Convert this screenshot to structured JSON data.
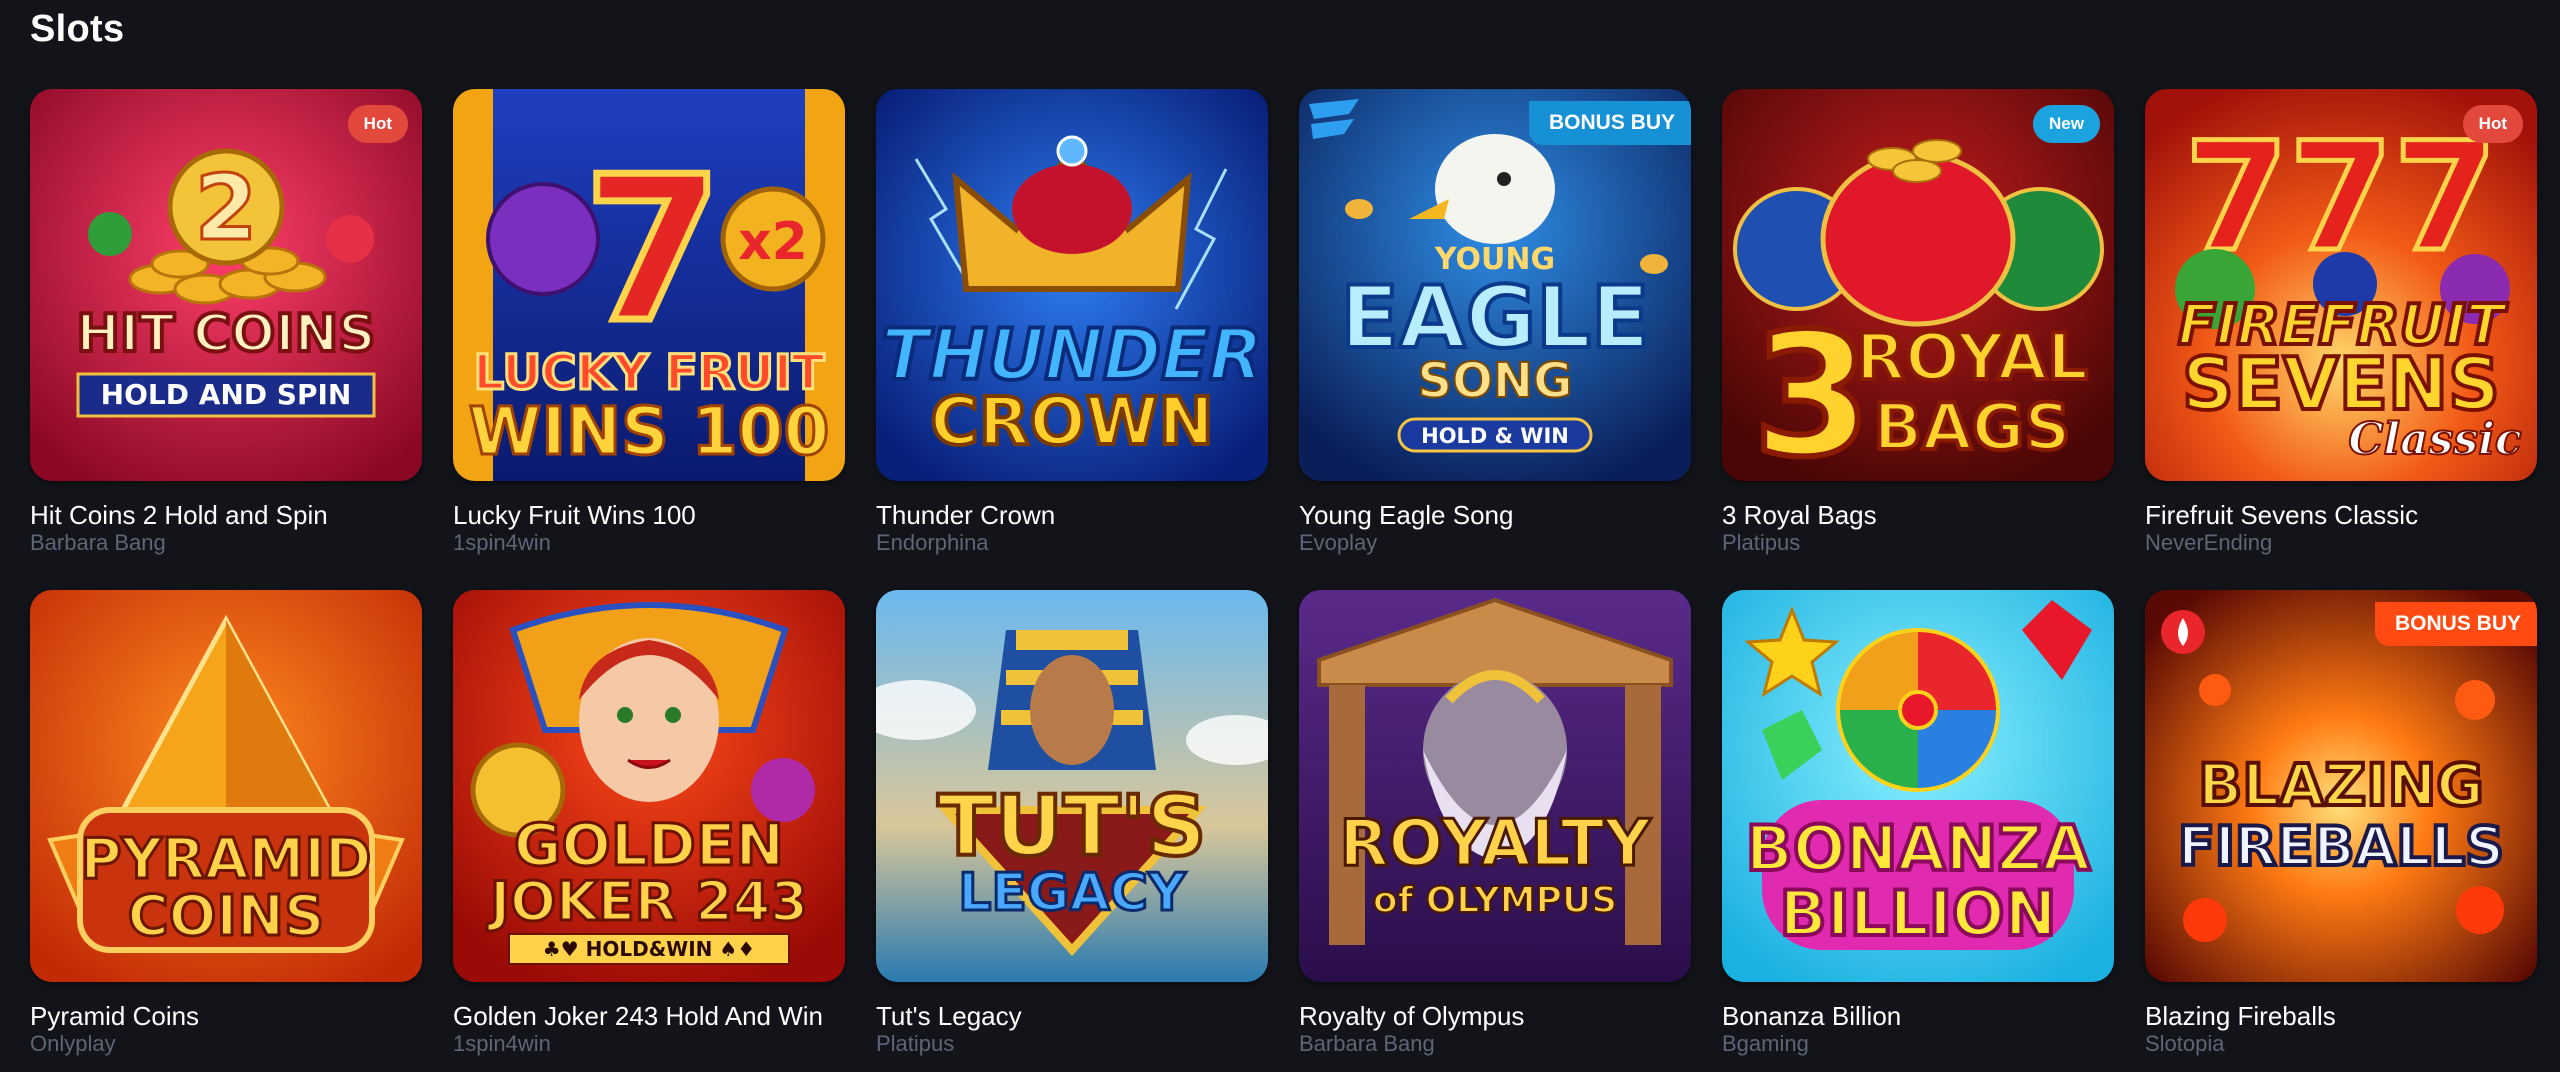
{
  "section": {
    "title": "Slots"
  },
  "games": [
    {
      "title": "Hit Coins 2 Hold and Spin",
      "provider": "Barbara Bang",
      "badge": "Hot",
      "logo": [
        "2",
        "HIT COINS",
        "HOLD AND SPIN"
      ]
    },
    {
      "title": "Lucky Fruit Wins 100",
      "provider": "1spin4win",
      "badge": "",
      "logo": [
        "7",
        "x2",
        "LUCKY FRUIT",
        "WINS 100"
      ]
    },
    {
      "title": "Thunder Crown",
      "provider": "Endorphina",
      "badge": "",
      "logo": [
        "THUNDER",
        "CROWN"
      ]
    },
    {
      "title": "Young Eagle Song",
      "provider": "Evoplay",
      "badge": "BONUS BUY",
      "logo": [
        "YOUNG",
        "EAGLE",
        "SONG",
        "HOLD & WIN"
      ]
    },
    {
      "title": "3 Royal Bags",
      "provider": "Platipus",
      "badge": "New",
      "logo": [
        "3",
        "ROYAL",
        "BAGS"
      ]
    },
    {
      "title": "Firefruit Sevens Classic",
      "provider": "NeverEnding",
      "badge": "Hot",
      "logo": [
        "777",
        "FIREFRUIT",
        "SEVENS",
        "Classic"
      ]
    },
    {
      "title": "Pyramid Coins",
      "provider": "Onlyplay",
      "badge": "",
      "logo": [
        "PYRAMID",
        "COINS"
      ]
    },
    {
      "title": "Golden Joker 243 Hold And Win",
      "provider": "1spin4win",
      "badge": "",
      "logo": [
        "GOLDEN",
        "JOKER 243",
        "♣♥ HOLD&WIN ♠♦"
      ]
    },
    {
      "title": "Tut's Legacy",
      "provider": "Platipus",
      "badge": "",
      "logo": [
        "TUT'S",
        "LEGACY"
      ]
    },
    {
      "title": "Royalty of Olympus",
      "provider": "Barbara Bang",
      "badge": "",
      "logo": [
        "ROYALTY",
        "of OLYMPUS"
      ]
    },
    {
      "title": "Bonanza Billion",
      "provider": "Bgaming",
      "badge": "",
      "logo": [
        "BONANZA",
        "BILLION"
      ]
    },
    {
      "title": "Blazing Fireballs",
      "provider": "Slotopia",
      "badge": "BONUS BUY",
      "logo": [
        "BLAZING",
        "FIREBALLS"
      ]
    }
  ],
  "colors": {
    "background": "#121419",
    "provider_text": "#5e6577",
    "badge_hot": "#e2493c",
    "badge_new": "#1aa3df",
    "badge_bonus_blue": "#1791d6",
    "badge_bonus_orange": "#ff4a12"
  }
}
